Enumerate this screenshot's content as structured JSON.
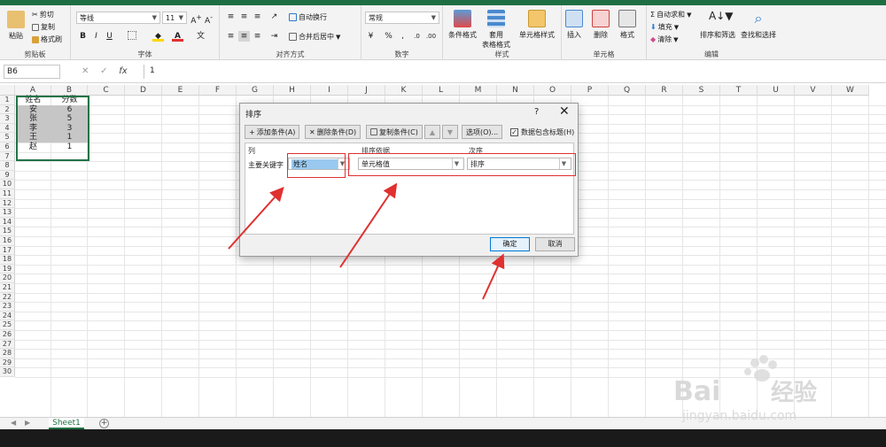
{
  "ribbon": {
    "clipboard": {
      "paste": "粘贴",
      "cut": "剪切",
      "copy": "复制",
      "format_painter": "格式刷",
      "label": "剪贴板"
    },
    "font": {
      "name": "等线",
      "size": "11",
      "bold": "B",
      "italic": "I",
      "underline": "U",
      "label": "字体"
    },
    "alignment": {
      "wrap": "自动换行",
      "merge": "合并后居中",
      "label": "对齐方式"
    },
    "number": {
      "format": "常规",
      "label": "数字"
    },
    "styles": {
      "conditional": "条件格式",
      "table_format": "套用\n表格格式",
      "cell_styles": "单元格样式",
      "label": "样式"
    },
    "cells": {
      "insert": "插入",
      "delete": "删除",
      "format": "格式",
      "label": "单元格"
    },
    "editing": {
      "autosum": "自动求和",
      "fill": "填充",
      "clear": "清除",
      "sort_filter": "排序和筛选",
      "find_select": "查找和选择",
      "label": "编辑"
    }
  },
  "formula_bar": {
    "name_box": "B6",
    "fx": "fx",
    "value": "1"
  },
  "sheet": {
    "columns": [
      "A",
      "B",
      "C",
      "D",
      "E",
      "F",
      "G",
      "H",
      "I",
      "J",
      "K",
      "L",
      "M",
      "N",
      "O",
      "P",
      "Q",
      "R",
      "S",
      "T",
      "U",
      "V",
      "W"
    ],
    "rows": [
      "1",
      "2",
      "3",
      "4",
      "5",
      "6",
      "7",
      "8",
      "9",
      "10",
      "11",
      "12",
      "13",
      "14",
      "15",
      "16",
      "17",
      "18",
      "19",
      "20",
      "21",
      "22",
      "23",
      "24",
      "25",
      "26",
      "27",
      "28",
      "29",
      "30"
    ],
    "header": [
      "姓名",
      "分数"
    ],
    "data": [
      [
        "安",
        "6"
      ],
      [
        "张",
        "5"
      ],
      [
        "李",
        "3"
      ],
      [
        "王",
        "1"
      ],
      [
        "赵",
        "1"
      ]
    ],
    "tab": "Sheet1",
    "add_tab": "+"
  },
  "dialog": {
    "title": "排序",
    "help": "?",
    "close": "✕",
    "add_level": "添加条件(A)",
    "delete_level": "删除条件(D)",
    "copy_level": "复制条件(C)",
    "options": "选项(O)...",
    "has_headers": "数据包含标题(H)",
    "col_header": "列",
    "sort_on_header": "排序依据",
    "order_header": "次序",
    "row_label": "主要关键字",
    "column_value": "姓名",
    "sort_on_value": "单元格值",
    "order_value": "排序",
    "ok": "确定",
    "cancel": "取消"
  },
  "colors": {
    "accent": "#217346",
    "selection_fill": "#c6c6c6",
    "annotation_red": "#e03030",
    "highlight_blue": "#99c9ef"
  }
}
